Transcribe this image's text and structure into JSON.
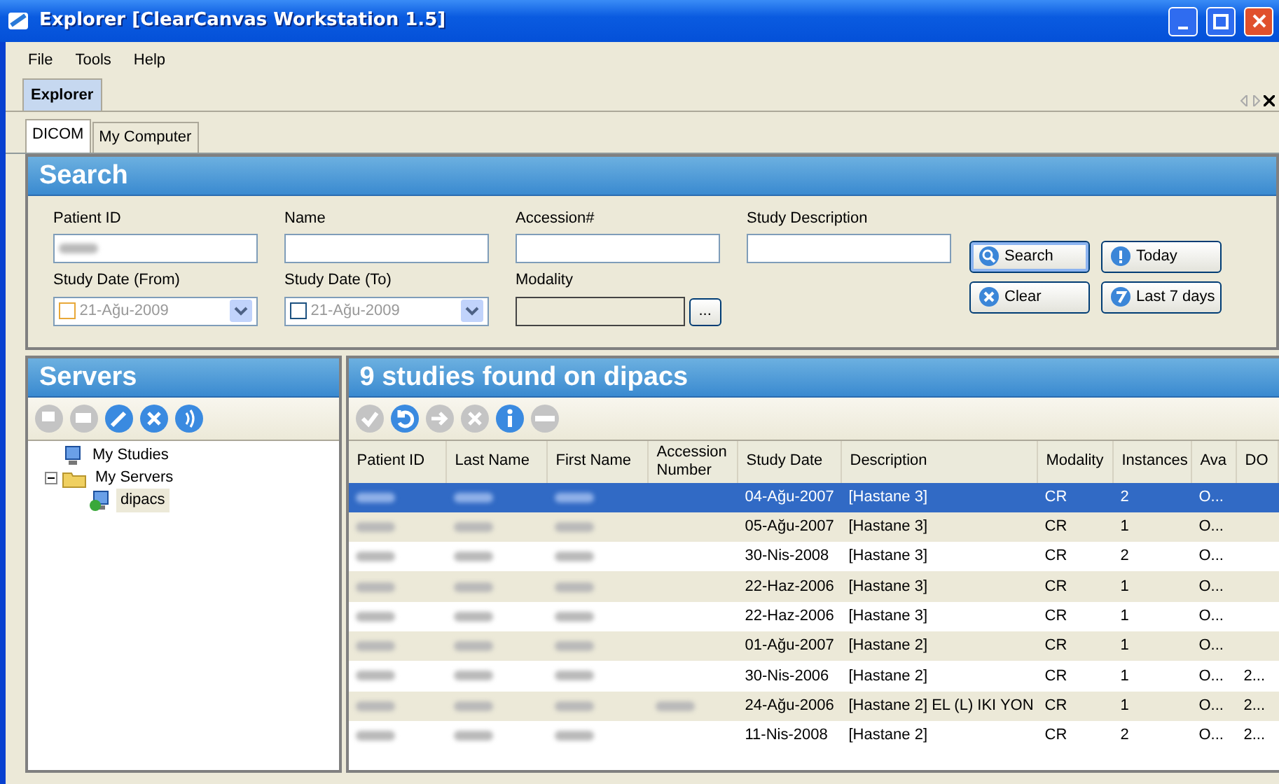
{
  "window": {
    "title": "Explorer [ClearCanvas Workstation 1.5]"
  },
  "menu": [
    "File",
    "Tools",
    "Help"
  ],
  "doc_tabs": [
    {
      "label": "Explorer",
      "selected": true
    }
  ],
  "tabs": [
    {
      "label": "DICOM",
      "selected": true
    },
    {
      "label": "My Computer",
      "selected": false
    }
  ],
  "search": {
    "title": "Search",
    "fields": [
      {
        "kind": "text",
        "label": "Patient ID",
        "value_blurred": true
      },
      {
        "kind": "text",
        "label": "Name",
        "value_blurred": false
      },
      {
        "kind": "text",
        "label": "Accession#",
        "value_blurred": false
      },
      {
        "kind": "text",
        "label": "Study Description",
        "value_blurred": false
      },
      {
        "kind": "date",
        "label": "Study Date (From)",
        "value": "21-Ağu-2009",
        "checked": false
      },
      {
        "kind": "date",
        "label": "Study Date (To)",
        "value": "21-Ağu-2009",
        "checked": false
      },
      {
        "kind": "picker",
        "label": "Modality",
        "button": "..."
      }
    ],
    "buttons": [
      {
        "label": "Search",
        "focused": true
      },
      {
        "label": "Today",
        "focused": false
      },
      {
        "label": "Clear",
        "focused": false
      },
      {
        "label": "Last 7 days",
        "focused": false
      }
    ]
  },
  "servers": {
    "title": "Servers",
    "toolbar": [
      {
        "disabled": true
      },
      {
        "disabled": true
      },
      {
        "disabled": false
      },
      {
        "disabled": false
      },
      {
        "disabled": false
      }
    ],
    "tree": [
      {
        "label": "My Studies",
        "selected": false
      },
      {
        "label": "My Servers",
        "selected": false,
        "expanded": true,
        "children": [
          {
            "label": "dipacs",
            "selected": true
          }
        ]
      }
    ]
  },
  "studies": {
    "title": "9 studies found on dipacs",
    "toolbar": [
      {
        "disabled": true
      },
      {
        "disabled": false
      },
      {
        "disabled": true
      },
      {
        "disabled": true
      },
      {
        "disabled": false
      },
      {
        "disabled": true
      }
    ],
    "columns": [
      "Patient ID",
      "Last Name",
      "First Name",
      "Accession Number",
      "Study Date",
      "Description",
      "Modality",
      "Instances",
      "Ava",
      "DO"
    ],
    "rows": [
      {
        "selected": true,
        "cells": [
          {
            "blurred": true
          },
          {
            "blurred": true
          },
          {
            "blurred": true
          },
          {
            "text": ""
          },
          {
            "text": "04-Ağu-2007"
          },
          {
            "text": "[Hastane 3]"
          },
          {
            "text": "CR"
          },
          {
            "text": "2"
          },
          {
            "text": "O..."
          },
          {
            "text": ""
          }
        ]
      },
      {
        "selected": false,
        "cells": [
          {
            "blurred": true
          },
          {
            "blurred": true
          },
          {
            "blurred": true
          },
          {
            "text": ""
          },
          {
            "text": "05-Ağu-2007"
          },
          {
            "text": "[Hastane 3]"
          },
          {
            "text": "CR"
          },
          {
            "text": "1"
          },
          {
            "text": "O..."
          },
          {
            "text": ""
          }
        ]
      },
      {
        "selected": false,
        "cells": [
          {
            "blurred": true
          },
          {
            "blurred": true
          },
          {
            "blurred": true
          },
          {
            "text": ""
          },
          {
            "text": "30-Nis-2008"
          },
          {
            "text": "[Hastane 3]"
          },
          {
            "text": "CR"
          },
          {
            "text": "2"
          },
          {
            "text": "O..."
          },
          {
            "text": ""
          }
        ]
      },
      {
        "selected": false,
        "cells": [
          {
            "blurred": true
          },
          {
            "blurred": true
          },
          {
            "blurred": true
          },
          {
            "text": ""
          },
          {
            "text": "22-Haz-2006"
          },
          {
            "text": "[Hastane 3]"
          },
          {
            "text": "CR"
          },
          {
            "text": "1"
          },
          {
            "text": "O..."
          },
          {
            "text": ""
          }
        ]
      },
      {
        "selected": false,
        "cells": [
          {
            "blurred": true
          },
          {
            "blurred": true
          },
          {
            "blurred": true
          },
          {
            "text": ""
          },
          {
            "text": "22-Haz-2006"
          },
          {
            "text": "[Hastane 3]"
          },
          {
            "text": "CR"
          },
          {
            "text": "1"
          },
          {
            "text": "O..."
          },
          {
            "text": ""
          }
        ]
      },
      {
        "selected": false,
        "cells": [
          {
            "blurred": true
          },
          {
            "blurred": true
          },
          {
            "blurred": true
          },
          {
            "text": ""
          },
          {
            "text": "01-Ağu-2007"
          },
          {
            "text": "[Hastane 2]"
          },
          {
            "text": "CR"
          },
          {
            "text": "1"
          },
          {
            "text": "O..."
          },
          {
            "text": ""
          }
        ]
      },
      {
        "selected": false,
        "cells": [
          {
            "blurred": true
          },
          {
            "blurred": true
          },
          {
            "blurred": true
          },
          {
            "text": ""
          },
          {
            "text": "30-Nis-2006"
          },
          {
            "text": "[Hastane 2]"
          },
          {
            "text": "CR"
          },
          {
            "text": "1"
          },
          {
            "text": "O..."
          },
          {
            "text": "2..."
          }
        ]
      },
      {
        "selected": false,
        "cells": [
          {
            "blurred": true
          },
          {
            "blurred": true
          },
          {
            "blurred": true
          },
          {
            "blurred": true
          },
          {
            "text": "24-Ağu-2006"
          },
          {
            "text": "[Hastane 2] EL (L) IKI YON"
          },
          {
            "text": "CR"
          },
          {
            "text": "1"
          },
          {
            "text": "O..."
          },
          {
            "text": "2..."
          }
        ]
      },
      {
        "selected": false,
        "cells": [
          {
            "blurred": true
          },
          {
            "blurred": true
          },
          {
            "blurred": true
          },
          {
            "text": ""
          },
          {
            "text": "11-Nis-2008"
          },
          {
            "text": "[Hastane 2]"
          },
          {
            "text": "CR"
          },
          {
            "text": "2"
          },
          {
            "text": "O..."
          },
          {
            "text": "2..."
          }
        ]
      }
    ]
  }
}
